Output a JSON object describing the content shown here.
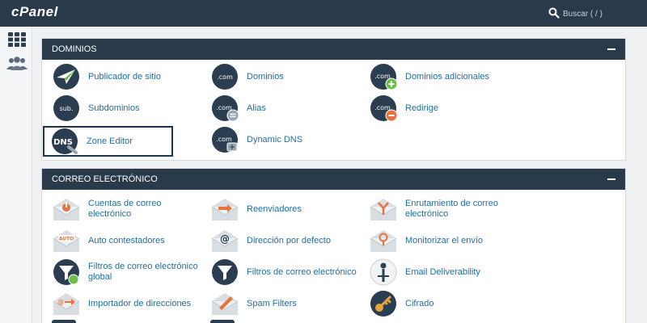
{
  "header": {
    "logo": "cPanel",
    "search_placeholder": "Buscar ( / )",
    "search_value": ""
  },
  "sidebar": {
    "items": [
      {
        "icon": "grid-icon",
        "label": "Inicio"
      },
      {
        "icon": "users-icon",
        "label": "Usuarios"
      }
    ]
  },
  "sections": [
    {
      "title": "DOMINIOS",
      "collapsed": false,
      "items": [
        {
          "label": "Publicador de sitio",
          "icon": "site-publisher-icon"
        },
        {
          "label": "Dominios",
          "icon": "dot-com-icon"
        },
        {
          "label": "Dominios adicionales",
          "icon": "dot-com-plus-icon"
        },
        {
          "label": "Subdominios",
          "icon": "sub-icon"
        },
        {
          "label": "Alias",
          "icon": "dot-com-minus-icon"
        },
        {
          "label": "Redirige",
          "icon": "dot-com-redirect-icon"
        },
        {
          "label": "Zone Editor",
          "icon": "dns-icon",
          "selected": true
        },
        {
          "label": "Dynamic DNS",
          "icon": "dot-com-dynamic-icon"
        }
      ]
    },
    {
      "title": "CORREO ELECTRÓNICO",
      "collapsed": false,
      "items": [
        {
          "label": "Cuentas de correo electrónico",
          "icon": "mail-accounts-icon"
        },
        {
          "label": "Reenviadores",
          "icon": "mail-forward-icon"
        },
        {
          "label": "Enrutamiento de correo electrónico",
          "icon": "mail-routing-icon"
        },
        {
          "label": "Auto contestadores",
          "icon": "mail-autoresponder-icon"
        },
        {
          "label": "Dirección por defecto",
          "icon": "mail-at-icon"
        },
        {
          "label": "Monitorizar el envío",
          "icon": "mail-monitor-icon"
        },
        {
          "label": "Filtros de correo electrónico global",
          "icon": "global-filter-icon"
        },
        {
          "label": "Filtros de correo electrónico",
          "icon": "filter-icon"
        },
        {
          "label": "Email Deliverability",
          "icon": "deliverability-icon"
        },
        {
          "label": "Importador de direcciones",
          "icon": "mail-import-icon"
        },
        {
          "label": "Spam Filters",
          "icon": "spam-filter-icon"
        },
        {
          "label": "Cifrado",
          "icon": "key-icon"
        }
      ]
    }
  ],
  "colors": {
    "topbar": "#293a4a",
    "link": "#1d6ea6",
    "accent_orange": "#e8733a",
    "accent_green": "#6bbf4a",
    "page_bg": "#eef0f2"
  }
}
